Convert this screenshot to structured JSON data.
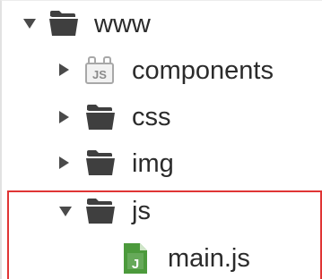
{
  "file_tree": {
    "root": {
      "label": "www",
      "expanded": true,
      "icon": "folder-icon"
    },
    "items": [
      {
        "label": "components",
        "expanded": false,
        "icon": "js-package-icon"
      },
      {
        "label": "css",
        "expanded": false,
        "icon": "folder-icon"
      },
      {
        "label": "img",
        "expanded": false,
        "icon": "folder-icon"
      },
      {
        "label": "js",
        "expanded": true,
        "icon": "folder-icon"
      }
    ],
    "file": {
      "label": "main.js",
      "icon": "js-file-icon"
    }
  },
  "colors": {
    "folder": "#3f3f3f",
    "js_file_green": "#4c9a3c",
    "highlight_border": "#e03535",
    "package_gray": "#a8a8a8"
  }
}
